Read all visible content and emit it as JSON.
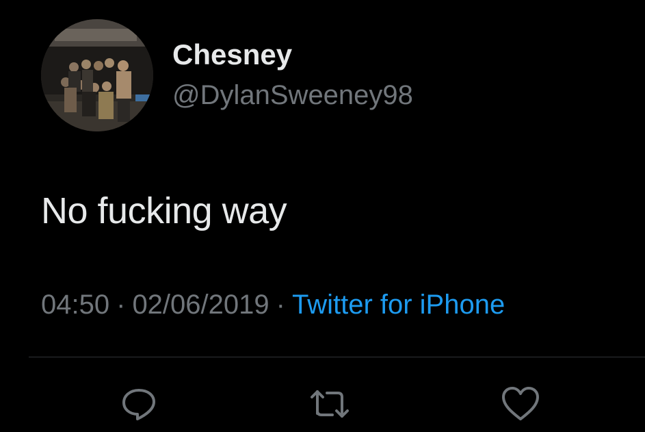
{
  "tweet": {
    "author": {
      "display_name": "Chesney",
      "handle": "@DylanSweeney98",
      "avatar_icon": "group-photo-avatar"
    },
    "text": "No fucking way",
    "time": "04:50",
    "separator": "·",
    "date": "02/06/2019",
    "source": "Twitter for iPhone"
  },
  "actions": {
    "reply_icon": "reply-icon",
    "retweet_icon": "retweet-icon",
    "like_icon": "heart-icon"
  },
  "colors": {
    "background": "#000000",
    "primary_text": "#e7e9ea",
    "secondary_text": "#71767b",
    "link": "#1d9bf0",
    "divider": "#2f3336"
  }
}
